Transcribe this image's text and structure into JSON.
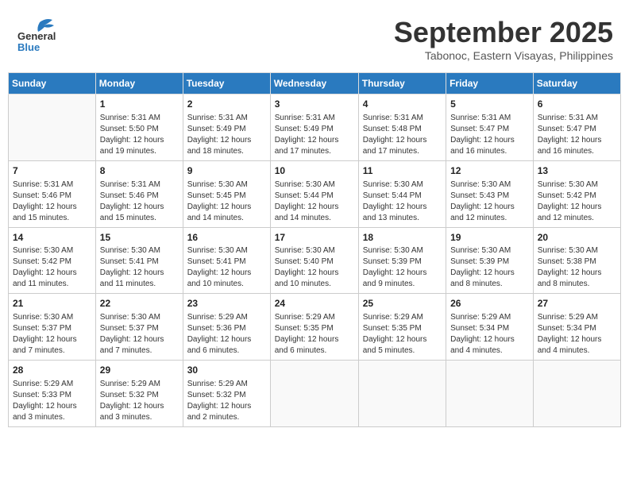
{
  "header": {
    "logo_general": "General",
    "logo_blue": "Blue",
    "month_title": "September 2025",
    "location": "Tabonoc, Eastern Visayas, Philippines"
  },
  "weekdays": [
    "Sunday",
    "Monday",
    "Tuesday",
    "Wednesday",
    "Thursday",
    "Friday",
    "Saturday"
  ],
  "weeks": [
    [
      {
        "day": "",
        "info": ""
      },
      {
        "day": "1",
        "info": "Sunrise: 5:31 AM\nSunset: 5:50 PM\nDaylight: 12 hours\nand 19 minutes."
      },
      {
        "day": "2",
        "info": "Sunrise: 5:31 AM\nSunset: 5:49 PM\nDaylight: 12 hours\nand 18 minutes."
      },
      {
        "day": "3",
        "info": "Sunrise: 5:31 AM\nSunset: 5:49 PM\nDaylight: 12 hours\nand 17 minutes."
      },
      {
        "day": "4",
        "info": "Sunrise: 5:31 AM\nSunset: 5:48 PM\nDaylight: 12 hours\nand 17 minutes."
      },
      {
        "day": "5",
        "info": "Sunrise: 5:31 AM\nSunset: 5:47 PM\nDaylight: 12 hours\nand 16 minutes."
      },
      {
        "day": "6",
        "info": "Sunrise: 5:31 AM\nSunset: 5:47 PM\nDaylight: 12 hours\nand 16 minutes."
      }
    ],
    [
      {
        "day": "7",
        "info": "Sunrise: 5:31 AM\nSunset: 5:46 PM\nDaylight: 12 hours\nand 15 minutes."
      },
      {
        "day": "8",
        "info": "Sunrise: 5:31 AM\nSunset: 5:46 PM\nDaylight: 12 hours\nand 15 minutes."
      },
      {
        "day": "9",
        "info": "Sunrise: 5:30 AM\nSunset: 5:45 PM\nDaylight: 12 hours\nand 14 minutes."
      },
      {
        "day": "10",
        "info": "Sunrise: 5:30 AM\nSunset: 5:44 PM\nDaylight: 12 hours\nand 14 minutes."
      },
      {
        "day": "11",
        "info": "Sunrise: 5:30 AM\nSunset: 5:44 PM\nDaylight: 12 hours\nand 13 minutes."
      },
      {
        "day": "12",
        "info": "Sunrise: 5:30 AM\nSunset: 5:43 PM\nDaylight: 12 hours\nand 12 minutes."
      },
      {
        "day": "13",
        "info": "Sunrise: 5:30 AM\nSunset: 5:42 PM\nDaylight: 12 hours\nand 12 minutes."
      }
    ],
    [
      {
        "day": "14",
        "info": "Sunrise: 5:30 AM\nSunset: 5:42 PM\nDaylight: 12 hours\nand 11 minutes."
      },
      {
        "day": "15",
        "info": "Sunrise: 5:30 AM\nSunset: 5:41 PM\nDaylight: 12 hours\nand 11 minutes."
      },
      {
        "day": "16",
        "info": "Sunrise: 5:30 AM\nSunset: 5:41 PM\nDaylight: 12 hours\nand 10 minutes."
      },
      {
        "day": "17",
        "info": "Sunrise: 5:30 AM\nSunset: 5:40 PM\nDaylight: 12 hours\nand 10 minutes."
      },
      {
        "day": "18",
        "info": "Sunrise: 5:30 AM\nSunset: 5:39 PM\nDaylight: 12 hours\nand 9 minutes."
      },
      {
        "day": "19",
        "info": "Sunrise: 5:30 AM\nSunset: 5:39 PM\nDaylight: 12 hours\nand 8 minutes."
      },
      {
        "day": "20",
        "info": "Sunrise: 5:30 AM\nSunset: 5:38 PM\nDaylight: 12 hours\nand 8 minutes."
      }
    ],
    [
      {
        "day": "21",
        "info": "Sunrise: 5:30 AM\nSunset: 5:37 PM\nDaylight: 12 hours\nand 7 minutes."
      },
      {
        "day": "22",
        "info": "Sunrise: 5:30 AM\nSunset: 5:37 PM\nDaylight: 12 hours\nand 7 minutes."
      },
      {
        "day": "23",
        "info": "Sunrise: 5:29 AM\nSunset: 5:36 PM\nDaylight: 12 hours\nand 6 minutes."
      },
      {
        "day": "24",
        "info": "Sunrise: 5:29 AM\nSunset: 5:35 PM\nDaylight: 12 hours\nand 6 minutes."
      },
      {
        "day": "25",
        "info": "Sunrise: 5:29 AM\nSunset: 5:35 PM\nDaylight: 12 hours\nand 5 minutes."
      },
      {
        "day": "26",
        "info": "Sunrise: 5:29 AM\nSunset: 5:34 PM\nDaylight: 12 hours\nand 4 minutes."
      },
      {
        "day": "27",
        "info": "Sunrise: 5:29 AM\nSunset: 5:34 PM\nDaylight: 12 hours\nand 4 minutes."
      }
    ],
    [
      {
        "day": "28",
        "info": "Sunrise: 5:29 AM\nSunset: 5:33 PM\nDaylight: 12 hours\nand 3 minutes."
      },
      {
        "day": "29",
        "info": "Sunrise: 5:29 AM\nSunset: 5:32 PM\nDaylight: 12 hours\nand 3 minutes."
      },
      {
        "day": "30",
        "info": "Sunrise: 5:29 AM\nSunset: 5:32 PM\nDaylight: 12 hours\nand 2 minutes."
      },
      {
        "day": "",
        "info": ""
      },
      {
        "day": "",
        "info": ""
      },
      {
        "day": "",
        "info": ""
      },
      {
        "day": "",
        "info": ""
      }
    ]
  ]
}
